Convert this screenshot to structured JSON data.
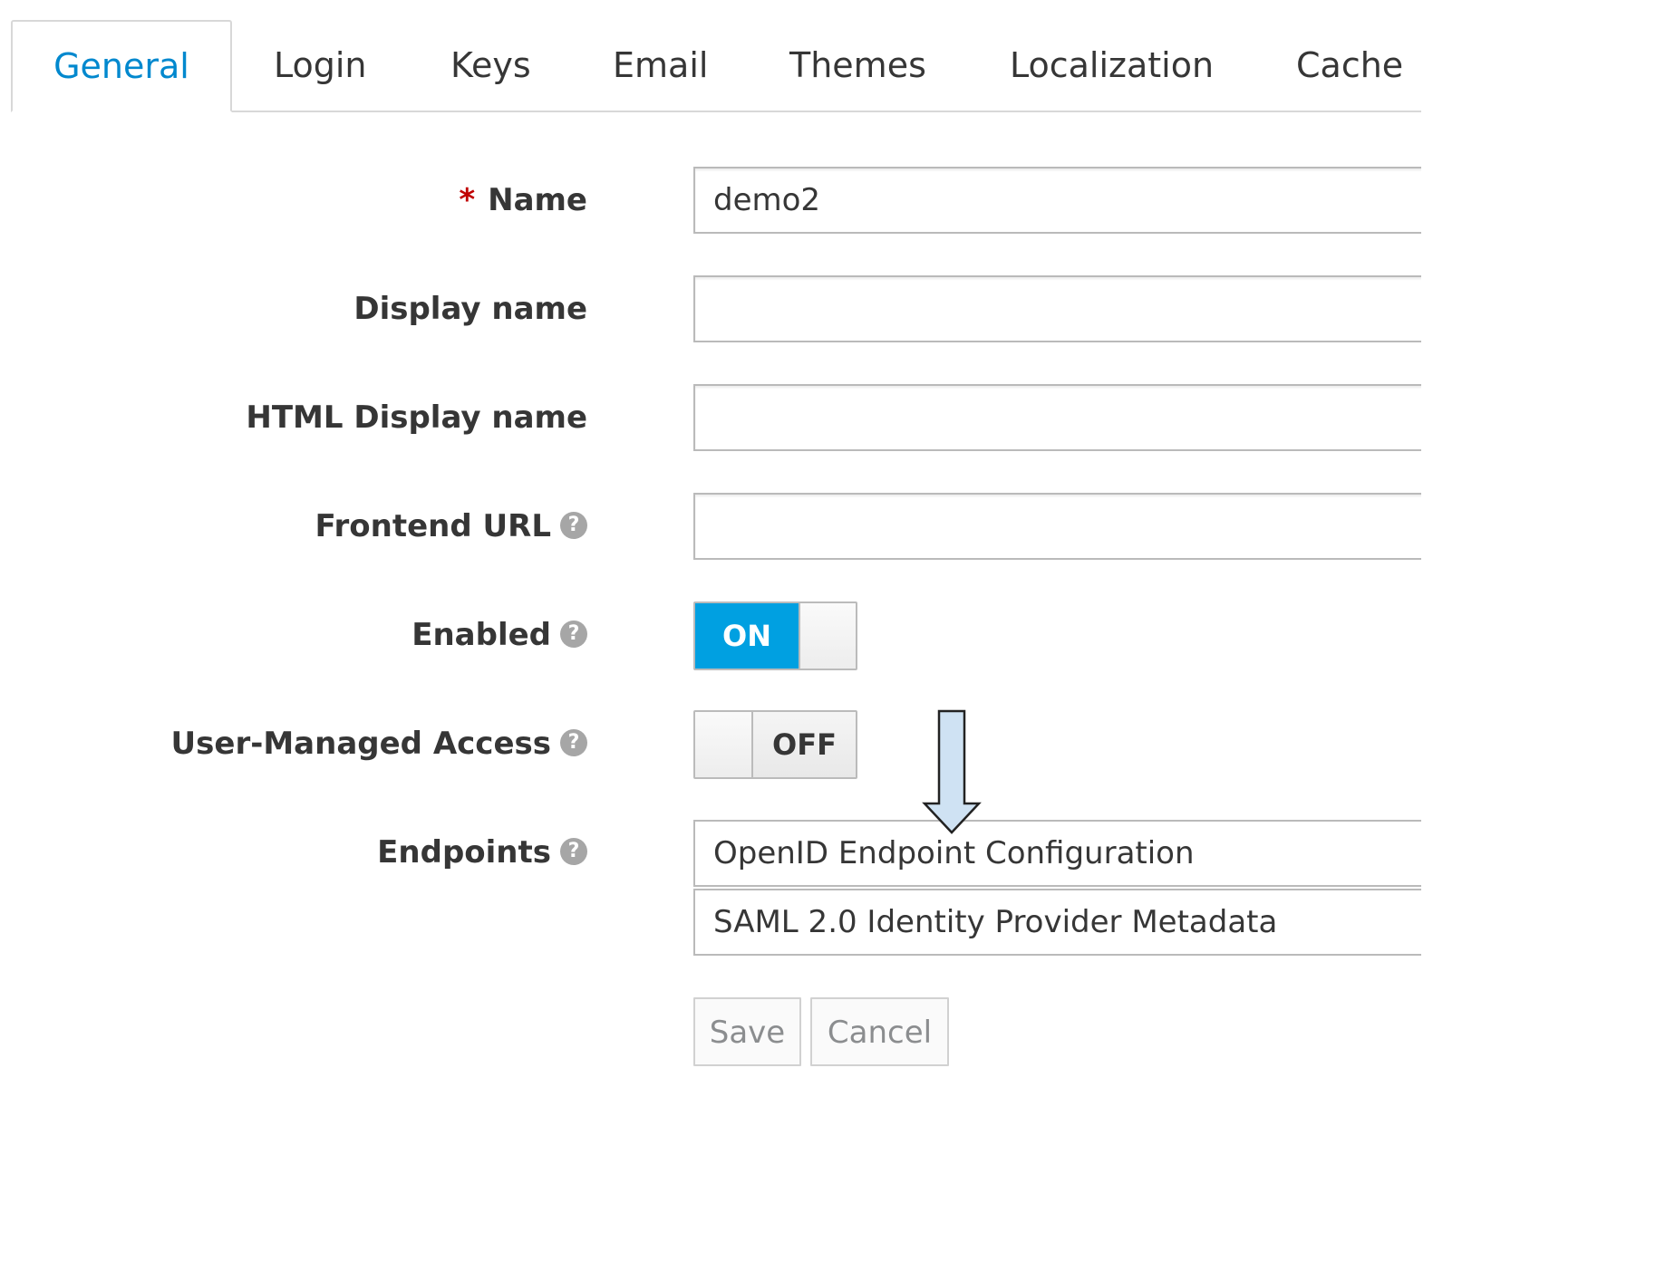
{
  "tabs": [
    {
      "label": "General",
      "active": true
    },
    {
      "label": "Login"
    },
    {
      "label": "Keys"
    },
    {
      "label": "Email"
    },
    {
      "label": "Themes"
    },
    {
      "label": "Localization"
    },
    {
      "label": "Cache"
    }
  ],
  "form": {
    "name": {
      "required_marker": "*",
      "label": "Name",
      "value": "demo2"
    },
    "display_name": {
      "label": "Display name",
      "value": ""
    },
    "html_display_name": {
      "label": "HTML Display name",
      "value": ""
    },
    "frontend_url": {
      "label": "Frontend URL",
      "value": "",
      "help_icon": "question-circle-icon"
    },
    "enabled": {
      "label": "Enabled",
      "state": "ON",
      "help_icon": "question-circle-icon"
    },
    "user_managed_access": {
      "label": "User-Managed Access",
      "state": "OFF",
      "help_icon": "question-circle-icon"
    },
    "endpoints": {
      "label": "Endpoints",
      "help_icon": "question-circle-icon",
      "items": [
        "OpenID Endpoint Configuration",
        "SAML 2.0 Identity Provider Metadata"
      ]
    }
  },
  "buttons": {
    "save": "Save",
    "cancel": "Cancel"
  },
  "colors": {
    "accent": "#0088ce",
    "switch_on": "#00a0e1",
    "required": "#c00000",
    "annotation_arrow_fill": "#cfe2f3"
  },
  "annotation": {
    "icon": "down-arrow-annotation"
  }
}
